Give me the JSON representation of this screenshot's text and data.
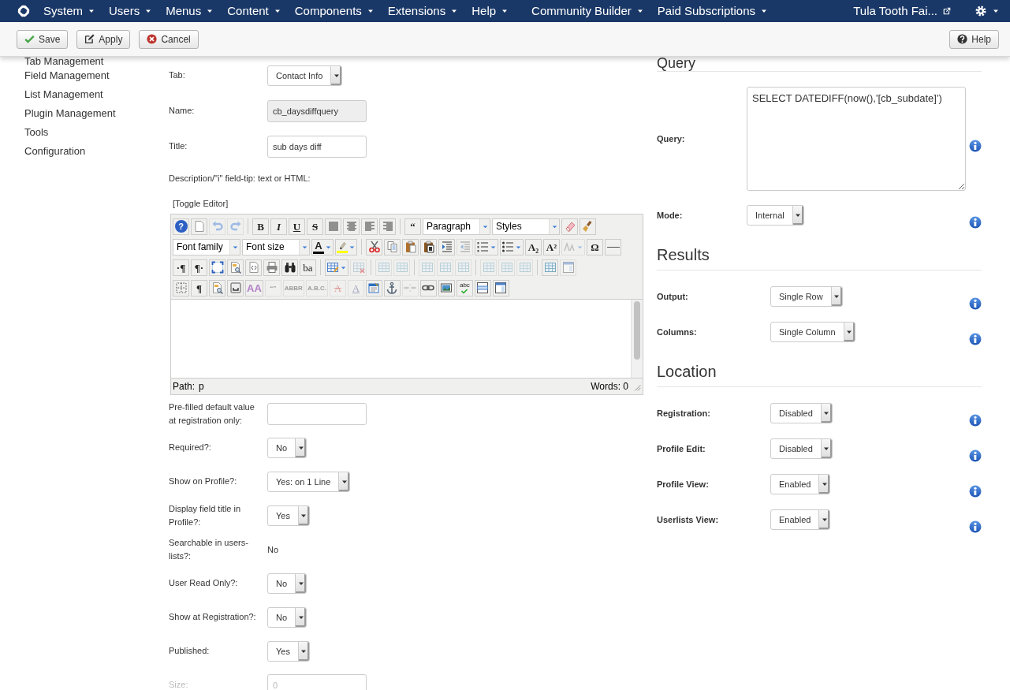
{
  "navbar": {
    "menus": [
      {
        "label": "System"
      },
      {
        "label": "Users"
      },
      {
        "label": "Menus"
      },
      {
        "label": "Content"
      },
      {
        "label": "Components"
      },
      {
        "label": "Extensions"
      },
      {
        "label": "Help"
      }
    ],
    "extra_menus": [
      {
        "label": "Community Builder"
      },
      {
        "label": "Paid Subscriptions"
      }
    ],
    "site": "Tula Tooth Fai..."
  },
  "toolbar": {
    "buttons": [
      {
        "kind": "save",
        "label": "Save"
      },
      {
        "kind": "apply",
        "label": "Apply"
      },
      {
        "kind": "cancel",
        "label": "Cancel"
      }
    ],
    "help": "Help"
  },
  "sidebar": {
    "items": [
      {
        "label": "Tab Management"
      },
      {
        "label": "Field Management"
      },
      {
        "label": "List Management"
      },
      {
        "label": "Plugin Management"
      },
      {
        "label": "Tools"
      },
      {
        "label": "Configuration"
      }
    ]
  },
  "form": {
    "rows": [
      {
        "label": "Tab:",
        "kind": "select",
        "value": "Contact Info",
        "disabled": false
      },
      {
        "label": "Name:",
        "kind": "readonly",
        "value": "cb_daysdiffquery",
        "disabled": false
      },
      {
        "label": "Title:",
        "kind": "input",
        "value": "sub days diff",
        "disabled": false
      },
      {
        "label": "Description/\"i\" field-tip: text or HTML:",
        "kind": "editor",
        "toggle": "[Toggle Editor]",
        "editor": {
          "toolbar_rows": [
            [
              {
                "kind": "round",
                "label": "?",
                "disabled": false
              },
              {
                "kind": "page",
                "disabled": false
              },
              {
                "kind": "undo",
                "disabled": true
              },
              {
                "kind": "redo",
                "disabled": true
              },
              {
                "kind": "sep"
              },
              {
                "kind": "bold",
                "label": "B",
                "disabled": false
              },
              {
                "kind": "italic",
                "label": "I",
                "disabled": false
              },
              {
                "kind": "underline",
                "label": "U",
                "disabled": false
              },
              {
                "kind": "strike",
                "label": "S",
                "disabled": false
              },
              {
                "kind": "justify",
                "disabled": false
              },
              {
                "kind": "center",
                "disabled": false
              },
              {
                "kind": "left",
                "disabled": false
              },
              {
                "kind": "right",
                "disabled": false
              },
              {
                "kind": "sep"
              },
              {
                "kind": "quote",
                "label": "“",
                "disabled": false
              },
              {
                "kind": "select",
                "label": "Paragraph"
              },
              {
                "kind": "select",
                "label": "Styles"
              },
              {
                "kind": "eraser",
                "disabled": false
              },
              {
                "kind": "brush",
                "disabled": false
              }
            ],
            [
              {
                "kind": "select",
                "label": "Font family"
              },
              {
                "kind": "select",
                "label": "Font size"
              },
              {
                "kind": "forecolor",
                "label": "A",
                "color": "#000000",
                "menu": true,
                "disabled": false
              },
              {
                "kind": "backcolor",
                "color": "#ffff00",
                "menu": true,
                "disabled": false
              },
              {
                "kind": "sep"
              },
              {
                "kind": "cut",
                "disabled": false
              },
              {
                "kind": "copy",
                "disabled": false
              },
              {
                "kind": "paste",
                "disabled": false
              },
              {
                "kind": "pastetext",
                "disabled": false
              },
              {
                "kind": "indent",
                "disabled": false
              },
              {
                "kind": "outdent",
                "disabled": true
              },
              {
                "kind": "ol",
                "menu": true,
                "disabled": false
              },
              {
                "kind": "ul",
                "menu": true,
                "disabled": false
              },
              {
                "kind": "subscript",
                "label": "A₂",
                "disabled": false
              },
              {
                "kind": "superscript",
                "label": "A²",
                "disabled": false
              },
              {
                "kind": "direction",
                "menu": true,
                "disabled": true
              },
              {
                "kind": "omega",
                "label": "Ω",
                "disabled": false
              },
              {
                "kind": "hr",
                "disabled": false
              }
            ],
            [
              {
                "kind": "ltr",
                "label": "·¶",
                "disabled": false
              },
              {
                "kind": "rtl",
                "label": "¶·",
                "disabled": false
              },
              {
                "kind": "fullscreen",
                "disabled": false
              },
              {
                "kind": "preview",
                "disabled": false
              },
              {
                "kind": "code",
                "disabled": false
              },
              {
                "kind": "print",
                "disabled": false
              },
              {
                "kind": "search",
                "disabled": false
              },
              {
                "kind": "replace",
                "label": "ba",
                "disabled": false
              },
              {
                "kind": "sep"
              },
              {
                "kind": "table",
                "menu": true,
                "disabled": false
              },
              {
                "kind": "tabledel",
                "disabled": true
              },
              {
                "kind": "sep"
              },
              {
                "kind": "grid",
                "disabled": true
              },
              {
                "kind": "grid",
                "disabled": true
              },
              {
                "kind": "sep"
              },
              {
                "kind": "grid",
                "disabled": true
              },
              {
                "kind": "grid",
                "disabled": true
              },
              {
                "kind": "grid",
                "disabled": true
              },
              {
                "kind": "sep"
              },
              {
                "kind": "grid",
                "disabled": true
              },
              {
                "kind": "grid",
                "disabled": true
              },
              {
                "kind": "grid",
                "disabled": true
              },
              {
                "kind": "sep"
              },
              {
                "kind": "grid",
                "disabled": false
              },
              {
                "kind": "layer2",
                "disabled": true
              }
            ],
            [
              {
                "kind": "visualaid",
                "disabled": false
              },
              {
                "kind": "pilcrow",
                "label": "¶",
                "disabled": false
              },
              {
                "kind": "preview",
                "disabled": false
              },
              {
                "kind": "insert",
                "disabled": false
              },
              {
                "kind": "styles",
                "label": "AA",
                "disabled": false
              },
              {
                "kind": "cite",
                "label": "“”",
                "disabled": true
              },
              {
                "kind": "abbr",
                "label": "ABBR",
                "disabled": true
              },
              {
                "kind": "acronym",
                "label": "A.B.C.",
                "disabled": true
              },
              {
                "kind": "del",
                "label": "A",
                "disabled": true
              },
              {
                "kind": "ins",
                "label": "A",
                "disabled": true
              },
              {
                "kind": "attribs",
                "disabled": false
              },
              {
                "kind": "anchor",
                "disabled": false
              },
              {
                "kind": "unlink",
                "disabled": true
              },
              {
                "kind": "link",
                "disabled": false
              },
              {
                "kind": "image",
                "disabled": false
              },
              {
                "kind": "spell",
                "label": "abc",
                "disabled": false
              },
              {
                "kind": "layer",
                "disabled": false
              },
              {
                "kind": "layer2",
                "disabled": false
              }
            ]
          ],
          "path_label": "Path:",
          "path": "p",
          "words": "Words: 0"
        }
      },
      {
        "label": "Pre-filled default value at registration only:",
        "kind": "input",
        "disabled": false
      },
      {
        "label": "Required?:",
        "kind": "select",
        "value": "No",
        "disabled": false
      },
      {
        "label": "Show on Profile?:",
        "kind": "select",
        "value": "Yes: on 1 Line",
        "disabled": false
      },
      {
        "label": "Display field title in Profile?:",
        "kind": "select",
        "value": "Yes",
        "disabled": false
      },
      {
        "label": "Searchable in users-lists?:",
        "kind": "static",
        "value": "No",
        "disabled": false
      },
      {
        "label": "User Read Only?:",
        "kind": "select",
        "value": "No",
        "disabled": false
      },
      {
        "label": "Show at Registration?:",
        "kind": "select",
        "value": "No",
        "disabled": false
      },
      {
        "label": "Published:",
        "kind": "select",
        "value": "Yes",
        "disabled": false
      },
      {
        "label": "Size:",
        "kind": "input",
        "placeholder": "0",
        "disabled": true
      }
    ]
  },
  "panel": {
    "sections": [
      {
        "title": "Query",
        "rows": [
          {
            "label": "Query:",
            "kind": "textarea",
            "value": "SELECT DATEDIFF(now(),'[cb_subdate]')"
          },
          {
            "label": "Mode:",
            "kind": "select",
            "value": "Internal"
          }
        ]
      },
      {
        "title": "Results",
        "rows": [
          {
            "label": "Output:",
            "kind": "select",
            "value": "Single Row"
          },
          {
            "label": "Columns:",
            "kind": "select",
            "value": "Single Column"
          }
        ]
      },
      {
        "title": "Location",
        "rows": [
          {
            "label": "Registration:",
            "kind": "select",
            "value": "Disabled"
          },
          {
            "label": "Profile Edit:",
            "kind": "select",
            "value": "Disabled"
          },
          {
            "label": "Profile View:",
            "kind": "select",
            "value": "Enabled"
          },
          {
            "label": "Userlists View:",
            "kind": "select",
            "value": "Enabled"
          }
        ]
      }
    ]
  }
}
